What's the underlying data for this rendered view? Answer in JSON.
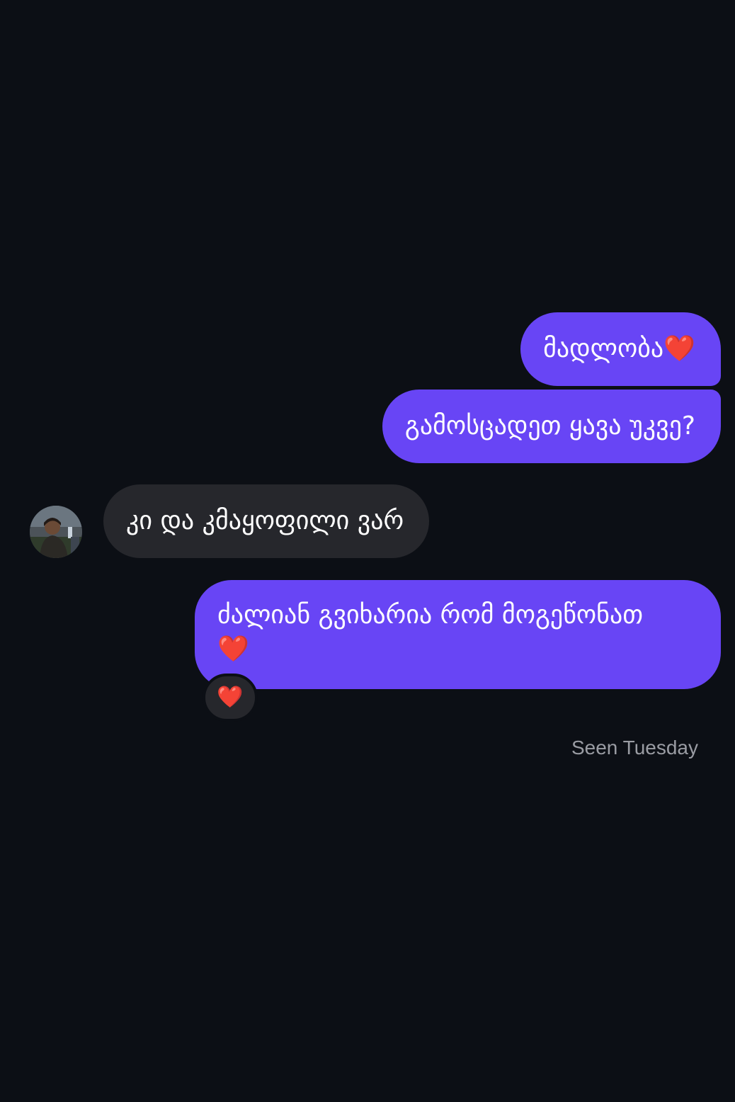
{
  "messages": [
    {
      "direction": "outgoing",
      "text": "მადლობა",
      "emoji": "❤️"
    },
    {
      "direction": "outgoing",
      "text": "გამოსცადეთ ყავა უკვე?"
    },
    {
      "direction": "incoming",
      "text": "კი და კმაყოფილი ვარ",
      "avatar": "user-avatar-photo"
    },
    {
      "direction": "outgoing",
      "text": "ძალიან გვიხარია რომ მოგეწონათ",
      "emoji": "❤️",
      "reaction": "❤️"
    }
  ],
  "status": {
    "seen": "Seen Tuesday"
  },
  "colors": {
    "background": "#0c0f15",
    "outgoing_bubble": "#6845f5",
    "incoming_bubble": "#26272c",
    "status_text": "#9a9ca3"
  }
}
